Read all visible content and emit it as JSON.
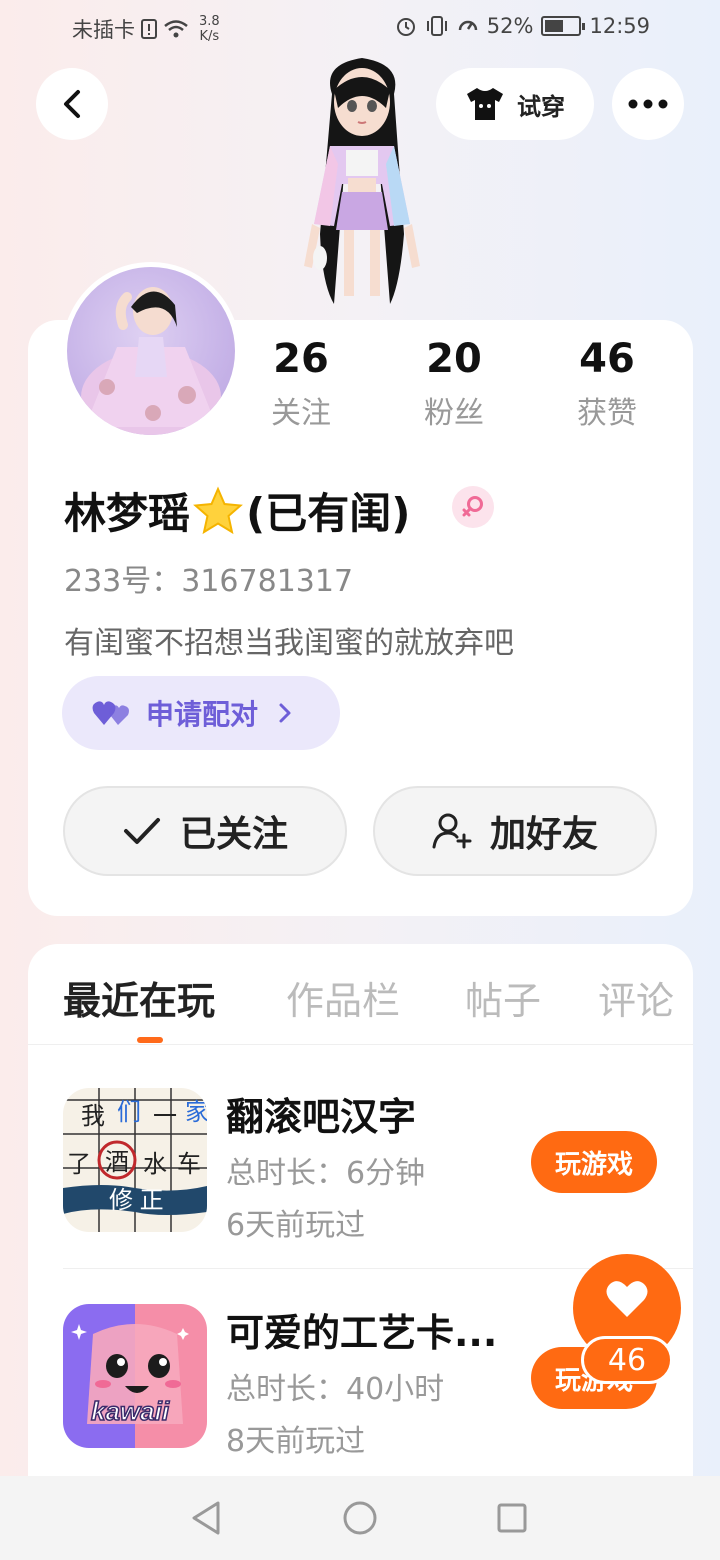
{
  "status_bar": {
    "carrier": "未插卡",
    "speed_value": "3.8",
    "speed_unit": "K/s",
    "battery": "52%",
    "time": "12:59"
  },
  "header": {
    "tryon_label": "试穿"
  },
  "profile": {
    "stats": [
      {
        "value": "26",
        "label": "关注"
      },
      {
        "value": "20",
        "label": "粉丝"
      },
      {
        "value": "46",
        "label": "获赞"
      }
    ],
    "name_part1": "林梦瑶",
    "name_part2": "(已有闺)",
    "id_text": "233号：316781317",
    "bio": "有闺蜜不招想当我闺蜜的就放弃吧",
    "pair_label": "申请配对",
    "follow_label": "已关注",
    "add_friend_label": "加好友"
  },
  "tabs": [
    "最近在玩",
    "作品栏",
    "帖子",
    "评论"
  ],
  "games": [
    {
      "title": "翻滚吧汉字",
      "duration": "总时长：6分钟",
      "last_played": "6天前玩过",
      "play_label": "玩游戏",
      "icon_chars": [
        "我",
        "们",
        "一",
        "家",
        "了",
        "酒",
        "水",
        "车"
      ],
      "icon_banner": "修 正"
    },
    {
      "title": "可爱的工艺卡...",
      "duration": "总时长：40小时",
      "last_played": "8天前玩过",
      "play_label": "玩游戏",
      "icon_text": "kawaii"
    }
  ],
  "like": {
    "count": "46"
  },
  "colors": {
    "accent": "#ff6a12",
    "pair": "#6e5ed8"
  }
}
